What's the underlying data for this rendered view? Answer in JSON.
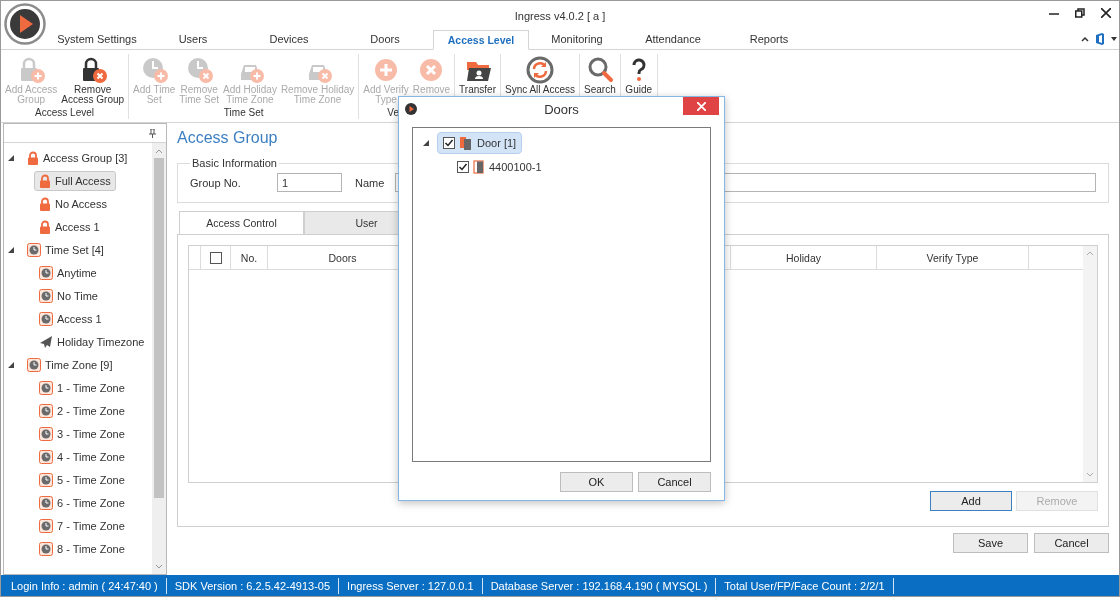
{
  "window": {
    "title": "Ingress v4.0.2 [ a ]"
  },
  "menu_tabs": [
    {
      "label": "System Settings",
      "selected": false
    },
    {
      "label": "Users",
      "selected": false
    },
    {
      "label": "Devices",
      "selected": false
    },
    {
      "label": "Doors",
      "selected": false
    },
    {
      "label": "Access Level",
      "selected": true
    },
    {
      "label": "Monitoring",
      "selected": false
    },
    {
      "label": "Attendance",
      "selected": false
    },
    {
      "label": "Reports",
      "selected": false
    }
  ],
  "ribbon": {
    "groups": [
      {
        "label": "Access Level",
        "buttons": [
          {
            "kind": "addgroup",
            "label": "Add Access\nGroup",
            "disabled": true
          },
          {
            "kind": "removegroup",
            "label": "Remove\nAccess Group",
            "disabled": false
          }
        ]
      },
      {
        "label": "Time Set",
        "buttons": [
          {
            "kind": "addset",
            "label": "Add Time\nSet",
            "disabled": true
          },
          {
            "kind": "removeset",
            "label": "Remove\nTime Set",
            "disabled": true
          },
          {
            "kind": "addholiday",
            "label": "Add Holiday\nTime Zone",
            "disabled": true
          },
          {
            "kind": "removeholiday",
            "label": "Remove Holiday\nTime Zone",
            "disabled": true
          }
        ]
      },
      {
        "label": "Ve",
        "buttons": [
          {
            "kind": "addverify",
            "label": "Add Verify\nType",
            "disabled": true
          },
          {
            "kind": "removeverify",
            "label": "Remove",
            "disabled": true
          }
        ]
      },
      {
        "buttons": [
          {
            "kind": "transfer",
            "label": "Transfer",
            "disabled": false
          }
        ]
      },
      {
        "buttons": [
          {
            "kind": "sync",
            "label": "Sync All Access",
            "disabled": false
          }
        ]
      },
      {
        "buttons": [
          {
            "kind": "search",
            "label": "Search",
            "disabled": false
          }
        ]
      },
      {
        "buttons": [
          {
            "kind": "guide",
            "label": "Guide",
            "disabled": false
          }
        ]
      }
    ]
  },
  "sidebar": {
    "tree": [
      {
        "kind": "lock",
        "label": "Access Group [3]",
        "expanded": true,
        "selected": false,
        "children": [
          {
            "kind": "lock",
            "label": "Full Access",
            "selected": true
          },
          {
            "kind": "lock",
            "label": "No Access",
            "selected": false
          },
          {
            "kind": "lock",
            "label": "Access 1",
            "selected": false
          }
        ]
      },
      {
        "kind": "clock",
        "label": "Time Set [4]",
        "expanded": true,
        "selected": false,
        "children": [
          {
            "kind": "clock",
            "label": "Anytime",
            "selected": false
          },
          {
            "kind": "clock",
            "label": "No Time",
            "selected": false
          },
          {
            "kind": "clock",
            "label": "Access 1",
            "selected": false
          },
          {
            "kind": "plane",
            "label": "Holiday Timezone",
            "selected": false
          }
        ]
      },
      {
        "kind": "clock",
        "label": "Time Zone [9]",
        "expanded": true,
        "selected": false,
        "children": [
          {
            "kind": "clock",
            "label": "1 - Time Zone",
            "selected": false
          },
          {
            "kind": "clock",
            "label": "2 - Time Zone",
            "selected": false
          },
          {
            "kind": "clock",
            "label": "3 - Time Zone",
            "selected": false
          },
          {
            "kind": "clock",
            "label": "4 - Time Zone",
            "selected": false
          },
          {
            "kind": "clock",
            "label": "5 - Time Zone",
            "selected": false
          },
          {
            "kind": "clock",
            "label": "6 - Time Zone",
            "selected": false
          },
          {
            "kind": "clock",
            "label": "7 - Time Zone",
            "selected": false
          },
          {
            "kind": "clock",
            "label": "8 - Time Zone",
            "selected": false
          }
        ]
      }
    ]
  },
  "page": {
    "title": "Access Group",
    "basic_information": {
      "legend": "Basic Information",
      "group_no": {
        "label": "Group No.",
        "value": "1"
      },
      "name": {
        "label": "Name"
      }
    },
    "tabs": [
      {
        "label": "Access Control",
        "selected": true
      },
      {
        "label": "User",
        "selected": false
      }
    ],
    "grid": {
      "select_all": {
        "checked": false
      },
      "columns": [
        {
          "label": "No."
        },
        {
          "label": "Doors"
        },
        {
          "label": "Holiday"
        },
        {
          "label": "Verify Type"
        }
      ]
    },
    "grid_buttons": [
      {
        "label": "Add",
        "disabled": false,
        "focused": true
      },
      {
        "label": "Remove",
        "disabled": true,
        "focused": false
      }
    ],
    "buttons": [
      {
        "label": "Save"
      },
      {
        "label": "Cancel"
      }
    ]
  },
  "dialog": {
    "title": "Doors",
    "tree": [
      {
        "kind": "group",
        "label": "Door [1]",
        "checked": true,
        "expanded": true,
        "selected": true,
        "children": [
          {
            "kind": "door",
            "label": "4400100-1",
            "checked": true,
            "selected": false
          }
        ]
      }
    ],
    "buttons": [
      {
        "label": "OK"
      },
      {
        "label": "Cancel"
      }
    ]
  },
  "status_bar": [
    "Login Info : admin ( 24:47:40 )",
    "SDK Version : 6.2.5.42-4913-05",
    "Ingress Server : 127.0.0.1",
    "Database Server : 192.168.4.190 ( MYSQL )",
    "Total User/FP/Face Count : 2/2/1"
  ]
}
